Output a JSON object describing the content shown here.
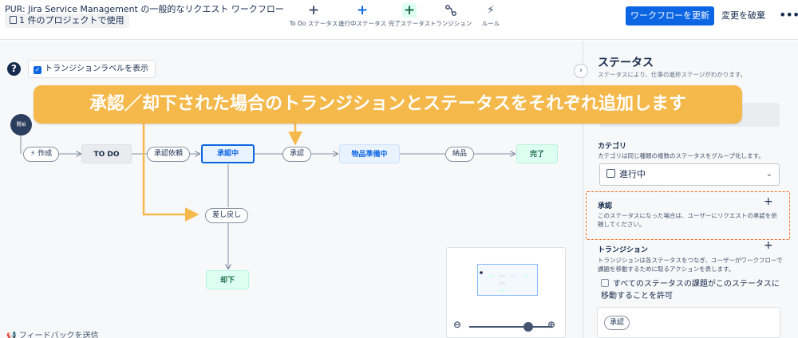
{
  "header": {
    "title": "PUR: Jira Service Management の一般的なリクエスト ワークフロー",
    "project_chip": "1 件のプロジェクトで使用",
    "tools": [
      {
        "label": "To Do ステータス",
        "icon": "plus-icon"
      },
      {
        "label": "進行中ステータス",
        "icon": "plus-icon"
      },
      {
        "label": "完了ステータス",
        "icon": "plus-icon"
      },
      {
        "label": "トランジション",
        "icon": "transition-icon"
      },
      {
        "label": "ルール",
        "icon": "lightning-icon"
      }
    ],
    "update_button": "ワークフローを更新",
    "discard_button": "変更を破棄",
    "more": "•••"
  },
  "canvas": {
    "help": "?",
    "show_labels": "トランジションラベルを表示",
    "start": "開始",
    "transitions": {
      "create": "作成",
      "request_approval": "承認依頼",
      "approve": "承認",
      "deliver": "納品",
      "send_back": "差し戻し"
    },
    "statuses": {
      "todo": "TO DO",
      "in_approval": "承認中",
      "preparing": "物品準備中",
      "done": "完了",
      "rejected": "却下"
    },
    "feedback": "フィードバックを送信"
  },
  "banner": "承認／却下された場合のトランジションとステータスをそれぞれ追加します",
  "panel": {
    "title": "ステータス",
    "subtitle": "ステータスにより、仕事の進捗ステージがわかります。",
    "category_label": "カテゴリ",
    "category_desc": "カテゴリは同じ種類の複数のステータスをグループ化します。",
    "category_value": "進行中",
    "approval_label": "承認",
    "approval_desc": "このステータスになった場合は、ユーザーにリクエストの承認を依頼してください。",
    "transition_label": "トランジション",
    "transition_desc": "トランジションは各ステータスをつなぎ、ユーザーがワークフローで課題を移動するために取るアクションを表します。",
    "allow_all": "すべてのステータスの課題がこのステータスに移動することを許可",
    "transition_chip": "承認"
  },
  "colors": {
    "primary": "#0c66e4",
    "banner": "#f5b84a",
    "dashed": "#f26b21"
  }
}
